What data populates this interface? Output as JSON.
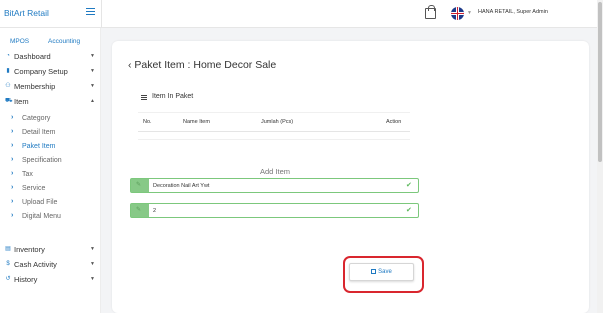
{
  "header": {
    "brand": "BitArt Retail",
    "user": "HANA RETAIL, Super Admin"
  },
  "sidebar": {
    "tabs": [
      "MPOS",
      "Accounting"
    ],
    "items": [
      {
        "label": "Dashboard",
        "icon": "dashboard-icon"
      },
      {
        "label": "Company Setup",
        "icon": "building-icon"
      },
      {
        "label": "Membership",
        "icon": "users-icon"
      },
      {
        "label": "Item",
        "icon": "cart-icon",
        "expanded": true
      },
      {
        "label": "Inventory",
        "icon": "inventory-icon"
      },
      {
        "label": "Cash Activity",
        "icon": "dollar-icon"
      },
      {
        "label": "History",
        "icon": "history-icon"
      }
    ],
    "subitems": [
      "Category",
      "Detail Item",
      "Paket Item",
      "Specification",
      "Tax",
      "Service",
      "Upload File",
      "Digital Menu"
    ],
    "active_subitem": "Paket Item"
  },
  "main": {
    "title": "Paket Item : Home Decor Sale",
    "section_title": "Item In Paket",
    "table": {
      "columns": [
        "No.",
        "Name Item",
        "Jumlah (Pcs)",
        "Action"
      ],
      "rows": []
    },
    "add_item": {
      "title": "Add Item",
      "item_value": "Decoration Nail Art Ywt",
      "qty_value": "2",
      "save_label": "Save"
    }
  },
  "colors": {
    "accent": "#1f7ac2",
    "success": "#5cb85c",
    "highlight": "#d9262e"
  }
}
